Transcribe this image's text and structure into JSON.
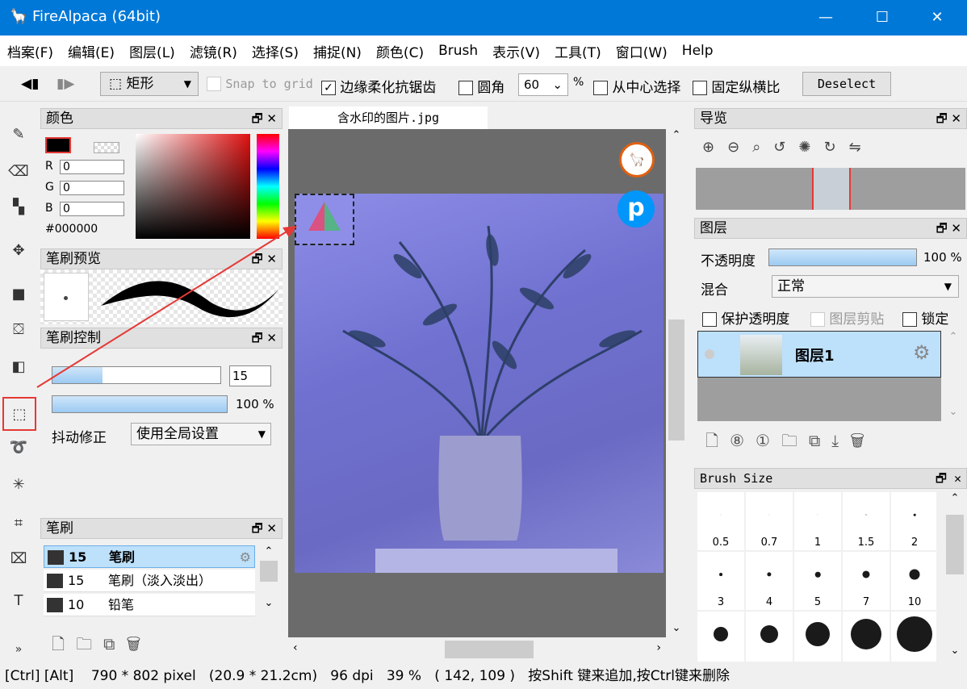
{
  "window": {
    "title": "FireAlpaca (64bit)",
    "minimize": "—",
    "maximize": "☐",
    "close": "✕"
  },
  "menu": [
    "档案(F)",
    "编辑(E)",
    "图层(L)",
    "滤镜(R)",
    "选择(S)",
    "捕捉(N)",
    "颜色(C)",
    "Brush",
    "表示(V)",
    "工具(T)",
    "窗口(W)",
    "Help"
  ],
  "toolbar": {
    "shape": "矩形",
    "snap_to_grid": "Snap to grid",
    "antialias": "边缘柔化抗锯齿",
    "antialias_checked": true,
    "round_corner": "圆角",
    "round_value": "60",
    "percent": "%",
    "from_center": "从中心选择",
    "fixed_ratio": "固定纵横比",
    "deselect": "Deselect"
  },
  "color_panel": {
    "title": "颜色",
    "r_label": "R",
    "r": "0",
    "g_label": "G",
    "g": "0",
    "b_label": "B",
    "b": "0",
    "hex": "#000000",
    "primary_color": "#000000"
  },
  "brush_preview": {
    "title": "笔刷预览"
  },
  "brush_control": {
    "title": "笔刷控制",
    "size": "15",
    "size_fill": 0.3,
    "opacity": "100",
    "opacity_unit": "%",
    "stabilizer_label": "抖动修正",
    "stabilizer_value": "使用全局设置"
  },
  "brush_panel": {
    "title": "笔刷",
    "items": [
      {
        "size": "15",
        "name": "笔刷",
        "selected": true
      },
      {
        "size": "15",
        "name": "笔刷（淡入淡出）"
      },
      {
        "size": "10",
        "name": "铅笔"
      }
    ]
  },
  "document": {
    "tab": "含水印的图片.jpg"
  },
  "navigator": {
    "title": "导览"
  },
  "layers": {
    "title": "图层",
    "opacity_label": "不透明度",
    "opacity": "100 %",
    "blend_label": "混合",
    "blend": "正常",
    "protect_alpha": "保护透明度",
    "clipping": "图层剪贴",
    "lock": "锁定",
    "layer_name": "图层1"
  },
  "brush_size": {
    "title": "Brush Size",
    "sizes": [
      "0.5",
      "0.7",
      "1",
      "1.5",
      "2",
      "3",
      "4",
      "5",
      "7",
      "10"
    ]
  },
  "status": {
    "keys": "[Ctrl] [Alt]",
    "pixels": "790 * 802 pixel",
    "cm": "(20.9 * 21.2cm)",
    "dpi": "96 dpi",
    "zoom": "39 %",
    "coords": "( 142, 109 )",
    "hint": "按Shift 键来追加,按Ctrl键来删除"
  },
  "colors": {
    "titlebar": "#0078d7",
    "selection": "#bde0fb",
    "highlight_red": "#e53935"
  }
}
